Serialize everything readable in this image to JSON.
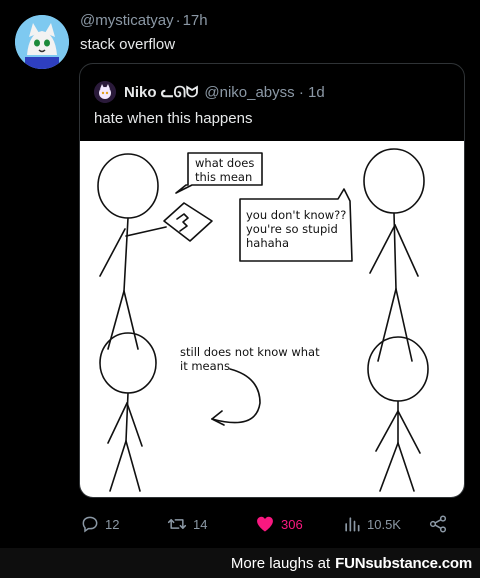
{
  "post": {
    "handle": "@mysticatyay",
    "age": "17h",
    "text": "stack overflow"
  },
  "quoted": {
    "name": "Niko",
    "name_symbols": "ᓚᘏᗢ",
    "handle": "@niko_abyss",
    "age": "1d",
    "text": "hate when this happens",
    "comic": {
      "panel1_bubble": "what does\nthis mean",
      "panel2_bubble": "you don't know??\nyou're so stupid\nhahaha",
      "panel3_caption": "still does not know what\nit means"
    }
  },
  "actions": {
    "replies": "12",
    "reposts": "14",
    "likes": "306",
    "views": "10.5K"
  },
  "footer": {
    "prefix": "More laughs at",
    "brand_fun": "FUN",
    "brand_rest": "substance.com"
  },
  "colors": {
    "background": "#000000",
    "muted": "#8b98a5",
    "like": "#f91880",
    "avatar": "#7ec9f0"
  },
  "icons": [
    "reply-icon",
    "repost-icon",
    "like-heart-icon",
    "views-icon",
    "share-icon"
  ]
}
